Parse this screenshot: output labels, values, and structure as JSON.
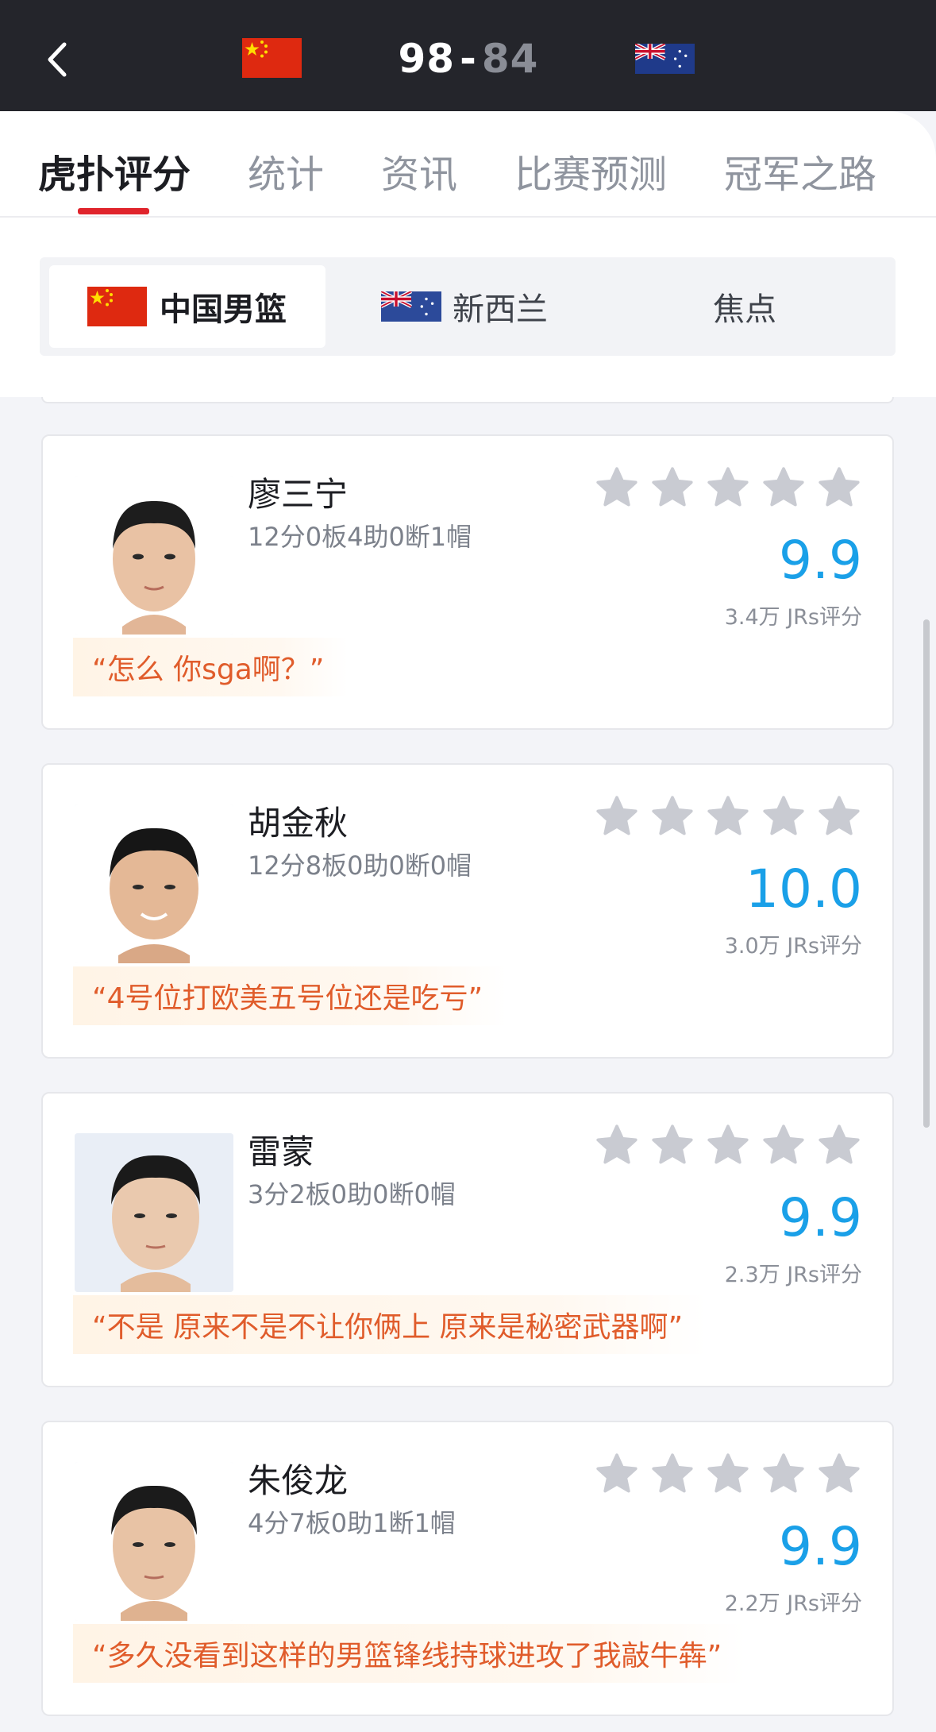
{
  "header": {
    "home_score": "98",
    "separator": "-",
    "away_score": "84",
    "home_flag": "china-flag",
    "away_flag": "new-zealand-flag"
  },
  "main_tabs": [
    {
      "label": "虎扑评分",
      "active": true
    },
    {
      "label": "统计",
      "active": false
    },
    {
      "label": "资讯",
      "active": false
    },
    {
      "label": "比赛预测",
      "active": false
    },
    {
      "label": "冠军之路",
      "active": false
    }
  ],
  "team_switch": [
    {
      "label": "中国男篮",
      "active": true,
      "flag": "china-flag"
    },
    {
      "label": "新西兰",
      "active": false,
      "flag": "new-zealand-flag"
    },
    {
      "label": "焦点",
      "active": false
    }
  ],
  "players": [
    {
      "name": "廖三宁",
      "stats": "12分0板4助0断1帽",
      "stars": 5,
      "rating": "9.9",
      "votes": "3.4万 JRs评分",
      "quote": "“怎么 你sga啊？”"
    },
    {
      "name": "胡金秋",
      "stats": "12分8板0助0断0帽",
      "stars": 5,
      "rating": "10.0",
      "votes": "3.0万 JRs评分",
      "quote": "“4号位打欧美五号位还是吃亏”"
    },
    {
      "name": "雷蒙",
      "stats": "3分2板0助0断0帽",
      "stars": 5,
      "rating": "9.9",
      "votes": "2.3万 JRs评分",
      "quote": "“不是 原来不是不让你俩上 原来是秘密武器啊”"
    },
    {
      "name": "朱俊龙",
      "stats": "4分7板0助1断1帽",
      "stars": 5,
      "rating": "9.9",
      "votes": "2.2万 JRs评分",
      "quote": "“多久没看到这样的男篮锋线持球进攻了我敲牛犇”"
    }
  ],
  "colors": {
    "header_bg": "#24252b",
    "active_tab_underline": "#e0242c",
    "rating_blue": "#1aa0e8",
    "quote_orange": "#e05c2b",
    "star_gray": "#c9cbd2"
  }
}
